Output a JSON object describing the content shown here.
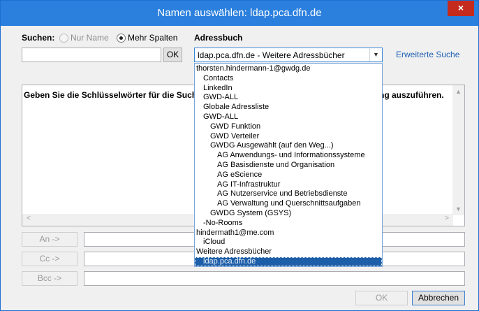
{
  "window": {
    "title": "Namen auswählen: ldap.pca.dfn.de",
    "close_symbol": "×"
  },
  "search": {
    "label": "Suchen:",
    "option_name_only": "Nur Name",
    "option_more_columns": "Mehr Spalten",
    "input_value": "",
    "ok_label": "OK"
  },
  "addressbook": {
    "label": "Adressbuch",
    "selected": "ldap.pca.dfn.de - Weitere Adressbücher",
    "advanced_search": "Erweiterte Suche",
    "options": [
      {
        "label": "thorsten.hindermann-1@gwdg.de",
        "level": 0
      },
      {
        "label": "Contacts",
        "level": 1
      },
      {
        "label": "LinkedIn",
        "level": 1
      },
      {
        "label": "GWD-ALL",
        "level": 1
      },
      {
        "label": "Globale Adressliste",
        "level": 1
      },
      {
        "label": "GWD-ALL",
        "level": 1
      },
      {
        "label": "GWD Funktion",
        "level": 2
      },
      {
        "label": "GWD Verteiler",
        "level": 2
      },
      {
        "label": "GWDG Ausgewählt (auf den Weg...)",
        "level": 2
      },
      {
        "label": "AG Anwendungs- und Informationssysteme",
        "level": 3
      },
      {
        "label": "AG Basisdienste und Organisation",
        "level": 3
      },
      {
        "label": "AG eScience",
        "level": 3
      },
      {
        "label": "AG IT-Infrastruktur",
        "level": 3
      },
      {
        "label": "AG Nutzerservice und Betriebsdienste",
        "level": 3
      },
      {
        "label": "AG Verwaltung und Querschnittsaufgaben",
        "level": 3
      },
      {
        "label": "GWDG System (GSYS)",
        "level": 2
      },
      {
        "label": "-No-Rooms",
        "level": 1
      },
      {
        "label": "hindermath1@me.com",
        "level": 0
      },
      {
        "label": "iCloud",
        "level": 1
      },
      {
        "label": "Weitere Adressbücher",
        "level": 0
      },
      {
        "label": "ldap.pca.dfn.de",
        "level": 1,
        "selected": true
      }
    ]
  },
  "results": {
    "info_start": "Geben Sie die Schlüsselwörter für die Suche e",
    "info_end": "ng auszuführen."
  },
  "recipients": {
    "to_label": "An ->",
    "cc_label": "Cc ->",
    "bcc_label": "Bcc ->"
  },
  "footer": {
    "ok_label": "OK",
    "cancel_label": "Abbrechen"
  },
  "colors": {
    "titlebar": "#2b80de",
    "close": "#c42b1c",
    "selection": "#1d5ea8",
    "link": "#1e5fb4"
  }
}
